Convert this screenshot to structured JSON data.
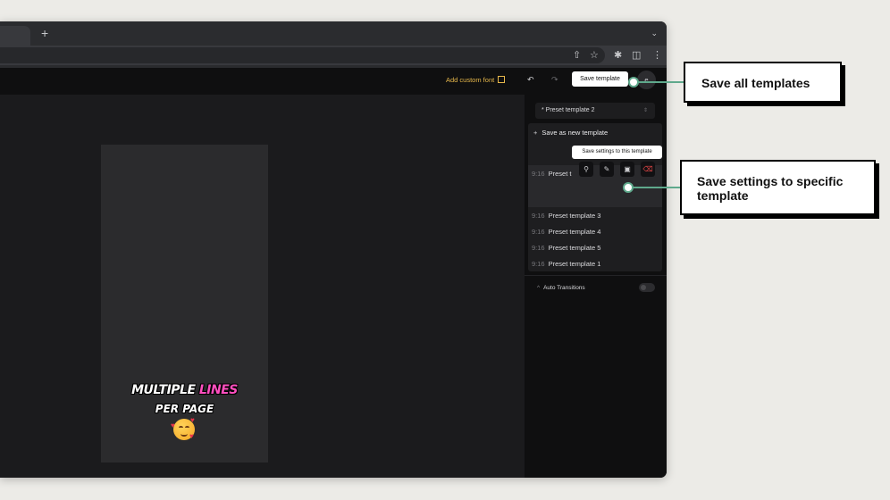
{
  "browser": {
    "new_tab_icon": "+",
    "tab_menu_icon": "chevron-down-icon",
    "toolbar_icons": [
      "share-icon",
      "star-icon",
      "extensions-icon",
      "sidepanel-icon",
      "kebab-menu-icon"
    ]
  },
  "header": {
    "custom_font_label": "Add custom font",
    "save_template_label": "Save template",
    "avatar_initial": "e"
  },
  "preview": {
    "caption_line1_a": "MULTIPLE ",
    "caption_line1_b": "LINES",
    "caption_line2": "PER PAGE",
    "highlight_color": "#ff4fbf"
  },
  "sidebar": {
    "selected_template": "* Preset template 2",
    "save_as_new_label": "Save as new template",
    "hover_item": {
      "ratio": "9:16",
      "name": "Preset t"
    },
    "tooltip": "Save settings to this template",
    "templates": [
      {
        "ratio": "9:16",
        "name": "Preset template 3"
      },
      {
        "ratio": "9:16",
        "name": "Preset template 4"
      },
      {
        "ratio": "9:16",
        "name": "Preset template 5"
      },
      {
        "ratio": "9:16",
        "name": "Preset template 1"
      }
    ],
    "auto_transitions_label": "Auto Transitions",
    "auto_transitions_on": false
  },
  "annotations": {
    "save_all": "Save all templates",
    "save_specific": "Save settings to specific template",
    "connector_color": "#5fa98c"
  },
  "colors": {
    "accent": "#e7b84b",
    "trash": "#e04545",
    "sidebar_bg": "#0f0f10"
  }
}
